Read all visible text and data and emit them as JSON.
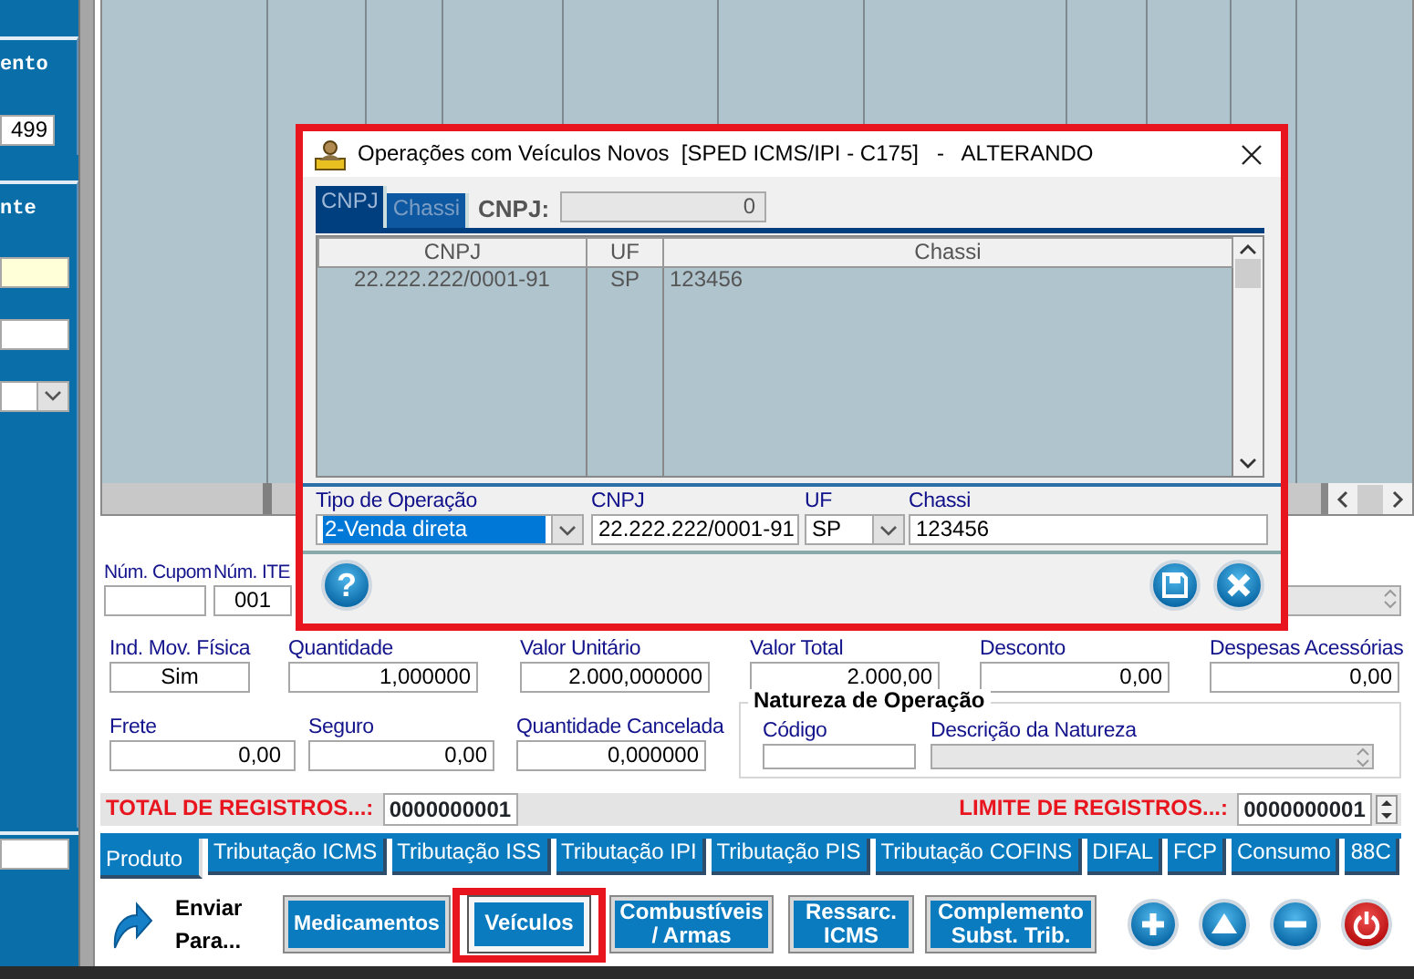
{
  "sidebar": {
    "sections": [
      {
        "title": "ento",
        "fields": [
          {
            "kind": "text",
            "value": "499"
          }
        ]
      },
      {
        "title": "nte",
        "fields": [
          {
            "kind": "required"
          },
          {
            "kind": "text"
          },
          {
            "kind": "select"
          }
        ]
      }
    ],
    "bottom_field": {
      "kind": "text"
    }
  },
  "form": {
    "rows": [
      [
        {
          "label": "Núm. Cupom",
          "kind": "text"
        },
        {
          "label": "Núm. ITE",
          "kind": "code",
          "value": "001"
        },
        {
          "kind": "spin",
          "disabled": true
        }
      ],
      [
        {
          "label": "Ind. Mov. Física",
          "kind": "code",
          "value": "Sim"
        },
        {
          "label": "Quantidade",
          "kind": "number",
          "value": "1,000000"
        },
        {
          "label": "Valor Unitário",
          "kind": "number",
          "value": "2.000,000000"
        },
        {
          "label": "Valor Total",
          "kind": "number",
          "value": "2.000,00"
        },
        {
          "label": "Desconto",
          "kind": "number",
          "value": "0,00"
        },
        {
          "label": "Despesas Acessórias",
          "kind": "number",
          "value": "0,00"
        }
      ],
      [
        {
          "label": "Frete",
          "kind": "number",
          "value": "0,00"
        },
        {
          "label": "Seguro",
          "kind": "number",
          "value": "0,00"
        },
        {
          "label": "Quantidade Cancelada",
          "kind": "number",
          "value": "0,000000"
        },
        {
          "kind": "group",
          "title": "Natureza de Operação",
          "fields": [
            {
              "label": "Código",
              "kind": "text"
            },
            {
              "label": "Descrição da Natureza",
              "kind": "spin",
              "disabled": true
            }
          ]
        }
      ]
    ]
  },
  "totals": {
    "total_label": "TOTAL DE REGISTROS...:",
    "total_value": "0000000001",
    "limit_label": "LIMITE DE REGISTROS...:",
    "limit_value": "0000000001"
  },
  "tabs": [
    {
      "label": "Produto",
      "selected": true
    },
    {
      "label": "Tributação ICMS",
      "selected": false
    },
    {
      "label": "Tributação ISS",
      "selected": false
    },
    {
      "label": "Tributação IPI",
      "selected": false
    },
    {
      "label": "Tributação PIS",
      "selected": false
    },
    {
      "label": "Tributação COFINS",
      "selected": false
    },
    {
      "label": "DIFAL",
      "selected": false
    },
    {
      "label": "FCP",
      "selected": false
    },
    {
      "label": "Consumo",
      "selected": false
    },
    {
      "label": "88C",
      "selected": false
    }
  ],
  "actions": {
    "send_label": "Enviar Para...",
    "buttons": [
      {
        "label": "Medicamentos",
        "highlighted": false
      },
      {
        "label": "Veículos",
        "highlighted": true
      },
      {
        "label": "Combustíveis / Armas",
        "highlighted": false
      },
      {
        "label": "Ressarc. ICMS",
        "highlighted": false
      },
      {
        "label": "Complemento Subst. Trib.",
        "highlighted": false
      }
    ],
    "round_buttons": [
      {
        "kind": "add"
      },
      {
        "kind": "up"
      },
      {
        "kind": "remove"
      },
      {
        "kind": "power"
      }
    ]
  },
  "dialog": {
    "title": "Operações com Veículos Novos  [SPED ICMS/IPI - C175]   -   ALTERANDO",
    "highlighted": true,
    "tabs": [
      {
        "label": "CNPJ",
        "selected": true
      },
      {
        "label": "Chassi",
        "selected": false
      }
    ],
    "filter": {
      "label": "CNPJ:",
      "value": "0"
    },
    "table": {
      "columns": [
        "CNPJ",
        "UF",
        "Chassi"
      ],
      "rows": [
        [
          "22.222.222/0001-91",
          "SP",
          "123456"
        ]
      ]
    },
    "fields": [
      {
        "label": "Tipo de Operação",
        "kind": "select",
        "value": "2-Venda direta",
        "focused": true
      },
      {
        "label": "CNPJ",
        "kind": "text",
        "value": "22.222.222/0001-91",
        "focused": false
      },
      {
        "label": "UF",
        "kind": "select",
        "value": "SP",
        "focused": false
      },
      {
        "label": "Chassi",
        "kind": "text",
        "value": "123456",
        "focused": false
      }
    ],
    "buttons": [
      {
        "kind": "help",
        "glyph": "?"
      },
      {
        "kind": "save"
      },
      {
        "kind": "close"
      }
    ]
  }
}
